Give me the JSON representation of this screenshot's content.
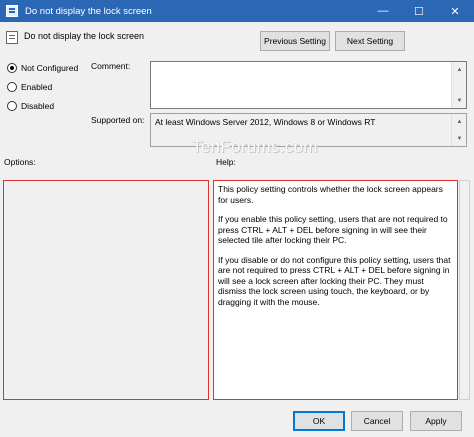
{
  "window": {
    "title": "Do not display the lock screen",
    "minimize_label": "—",
    "maximize_label": "☐",
    "close_label": "✕"
  },
  "header": {
    "setting_title": "Do not display the lock screen",
    "previous_setting": "Previous Setting",
    "next_setting": "Next Setting"
  },
  "state": {
    "options": [
      {
        "label": "Not Configured",
        "checked": true
      },
      {
        "label": "Enabled",
        "checked": false
      },
      {
        "label": "Disabled",
        "checked": false
      }
    ]
  },
  "comment": {
    "label": "Comment:",
    "value": ""
  },
  "supported": {
    "label": "Supported on:",
    "value": "At least Windows Server 2012, Windows 8 or Windows RT"
  },
  "watermark": "TenForums.com",
  "options_panel": {
    "label": "Options:"
  },
  "help_panel": {
    "label": "Help:",
    "paragraphs": [
      "This policy setting controls whether the lock screen appears for users.",
      "If you enable this policy setting, users that are not required to press CTRL + ALT + DEL before signing in will see their selected tile after locking their PC.",
      "If you disable or do not configure this policy setting, users that are not required to press CTRL + ALT + DEL before signing in will see a lock screen after locking their PC. They must dismiss the lock screen using touch, the keyboard, or by dragging it with the mouse."
    ]
  },
  "footer": {
    "ok": "OK",
    "cancel": "Cancel",
    "apply": "Apply"
  },
  "colors": {
    "titlebar": "#2b67b5",
    "highlight_border": "#e03232",
    "default_button_border": "#0078d7"
  }
}
